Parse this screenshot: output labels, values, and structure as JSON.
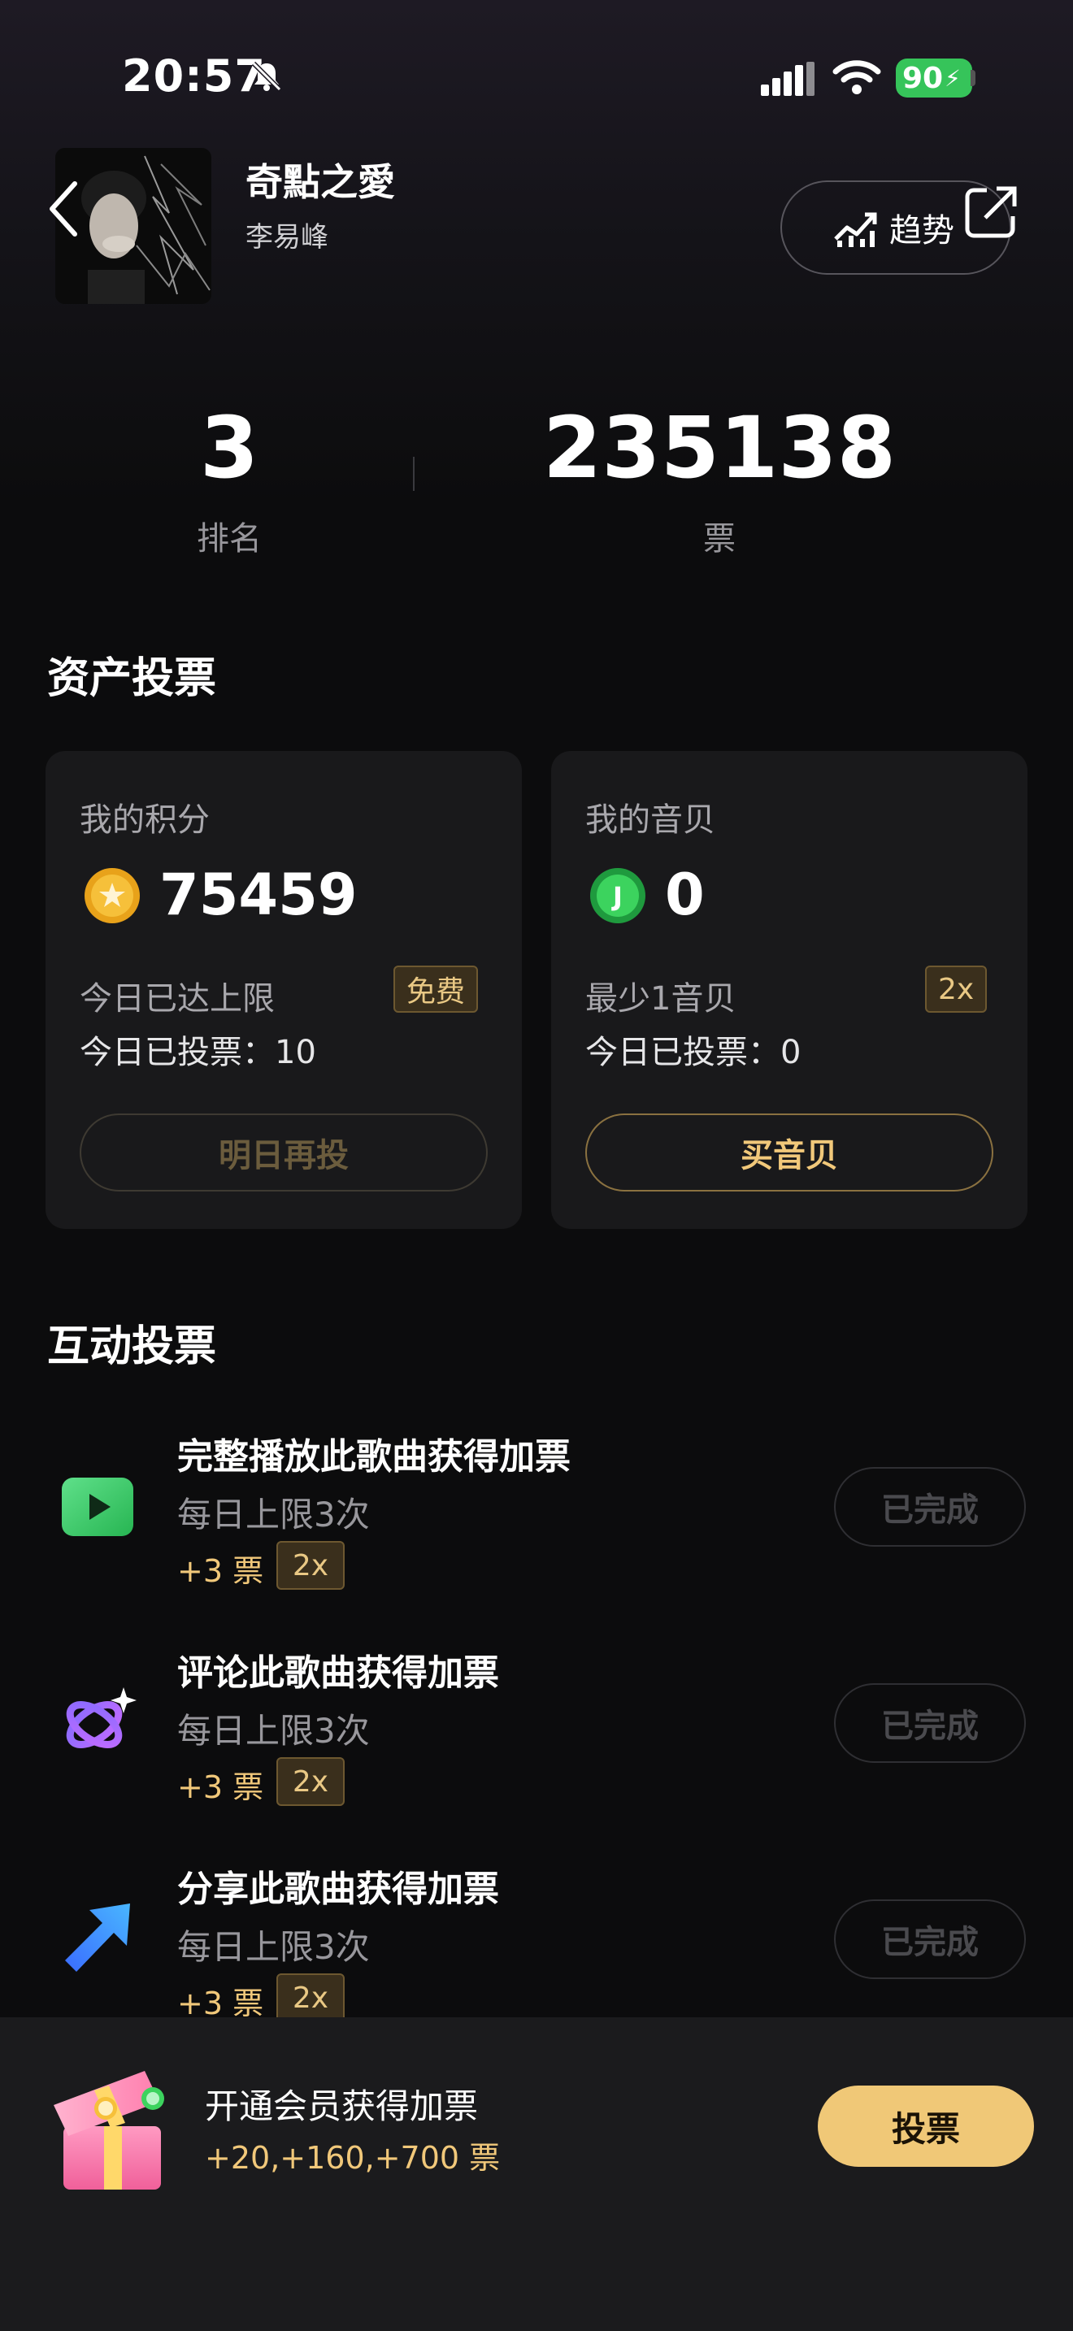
{
  "status_bar": {
    "time": "20:57",
    "battery": "90"
  },
  "header": {
    "song_title": "奇點之愛",
    "artist": "李易峰",
    "trend_label": "趋势"
  },
  "stats": {
    "rank_value": "3",
    "rank_label": "排名",
    "votes_value": "235138",
    "votes_label": "票"
  },
  "asset_section": {
    "title": "资产投票",
    "points_card": {
      "label": "我的积分",
      "value": "75459",
      "line1": "今日已达上限",
      "tag": "免费",
      "line2": "今日已投票：10",
      "button": "明日再投"
    },
    "shells_card": {
      "label": "我的音贝",
      "value": "0",
      "line1": "最少1音贝",
      "tag": "2x",
      "line2": "今日已投票：0",
      "button": "买音贝"
    }
  },
  "interactive_section": {
    "title": "互动投票",
    "tasks": [
      {
        "title": "完整播放此歌曲获得加票",
        "subtitle": "每日上限3次",
        "reward": "+3 票",
        "multiplier": "2x",
        "button": "已完成",
        "icon": "play-icon"
      },
      {
        "title": "评论此歌曲获得加票",
        "subtitle": "每日上限3次",
        "reward": "+3 票",
        "multiplier": "2x",
        "button": "已完成",
        "icon": "comment-orbit-icon"
      },
      {
        "title": "分享此歌曲获得加票",
        "subtitle": "每日上限3次",
        "reward": "+3 票",
        "multiplier": "2x",
        "button": "已完成",
        "icon": "share-arrow-icon"
      }
    ]
  },
  "bottom_bar": {
    "promo_title": "开通会员获得加票",
    "promo_sub": "+20,+160,+700 票",
    "vote_button": "投票"
  },
  "colors": {
    "accent_gold": "#f0c877",
    "battery_green": "#36c45a",
    "background": "#0c0c0d"
  }
}
